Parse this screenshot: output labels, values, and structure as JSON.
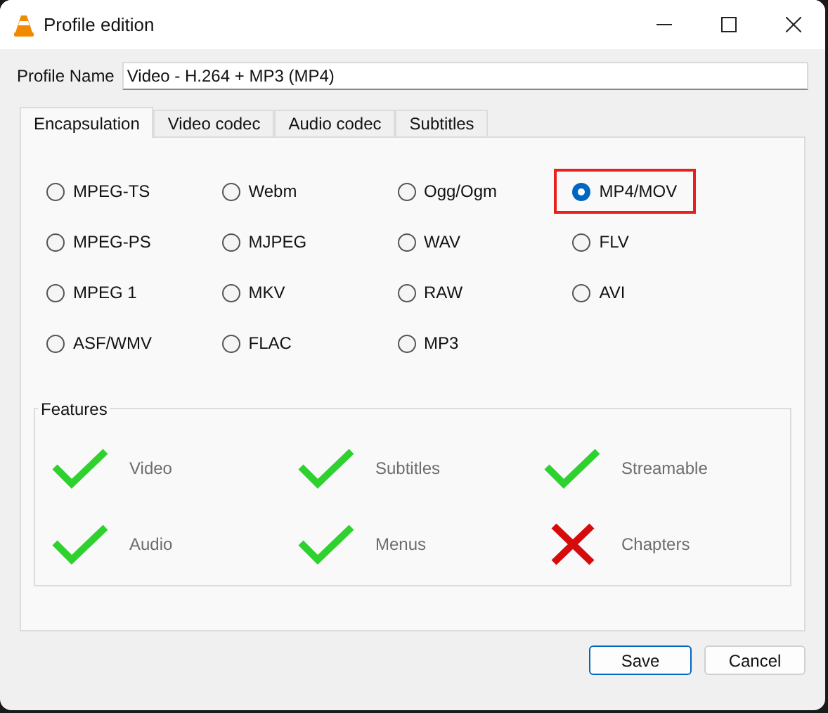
{
  "window": {
    "title": "Profile edition"
  },
  "profile_name": {
    "label": "Profile Name",
    "value": "Video - H.264 + MP3 (MP4)"
  },
  "tabs": [
    {
      "label": "Encapsulation",
      "selected": true
    },
    {
      "label": "Video codec",
      "selected": false
    },
    {
      "label": "Audio codec",
      "selected": false
    },
    {
      "label": "Subtitles",
      "selected": false
    }
  ],
  "formats": [
    {
      "label": "MPEG-TS",
      "selected": false,
      "highlighted": false
    },
    {
      "label": "Webm",
      "selected": false,
      "highlighted": false
    },
    {
      "label": "Ogg/Ogm",
      "selected": false,
      "highlighted": false
    },
    {
      "label": "MP4/MOV",
      "selected": true,
      "highlighted": true
    },
    {
      "label": "MPEG-PS",
      "selected": false,
      "highlighted": false
    },
    {
      "label": "MJPEG",
      "selected": false,
      "highlighted": false
    },
    {
      "label": "WAV",
      "selected": false,
      "highlighted": false
    },
    {
      "label": "FLV",
      "selected": false,
      "highlighted": false
    },
    {
      "label": "MPEG 1",
      "selected": false,
      "highlighted": false
    },
    {
      "label": "MKV",
      "selected": false,
      "highlighted": false
    },
    {
      "label": "RAW",
      "selected": false,
      "highlighted": false
    },
    {
      "label": "AVI",
      "selected": false,
      "highlighted": false
    },
    {
      "label": "ASF/WMV",
      "selected": false,
      "highlighted": false
    },
    {
      "label": "FLAC",
      "selected": false,
      "highlighted": false
    },
    {
      "label": "MP3",
      "selected": false,
      "highlighted": false
    }
  ],
  "features": {
    "title": "Features",
    "items": [
      {
        "label": "Video",
        "supported": true
      },
      {
        "label": "Subtitles",
        "supported": true
      },
      {
        "label": "Streamable",
        "supported": true
      },
      {
        "label": "Audio",
        "supported": true
      },
      {
        "label": "Menus",
        "supported": true
      },
      {
        "label": "Chapters",
        "supported": false
      }
    ]
  },
  "buttons": [
    {
      "label": "Save",
      "default": true
    },
    {
      "label": "Cancel",
      "default": false
    }
  ]
}
